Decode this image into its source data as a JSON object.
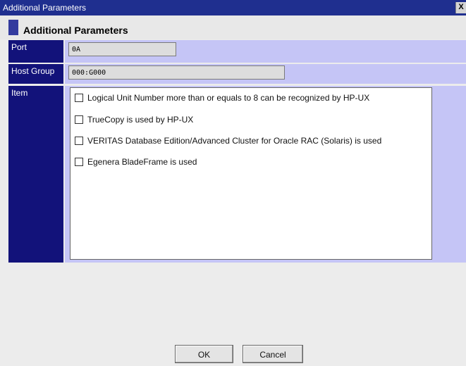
{
  "window": {
    "title": "Additional Parameters",
    "close_label": "X"
  },
  "header": {
    "title": "Additional Parameters"
  },
  "port": {
    "label": "Port",
    "value": "0A"
  },
  "host_group": {
    "label": "Host Group",
    "value": "000:G000"
  },
  "item": {
    "label": "Item",
    "options": [
      {
        "label": "Logical Unit Number more than or equals to 8 can be recognized by HP-UX",
        "checked": false
      },
      {
        "label": "TrueCopy is used by HP-UX",
        "checked": false
      },
      {
        "label": "VERITAS Database Edition/Advanced Cluster for Oracle RAC (Solaris) is used",
        "checked": false
      },
      {
        "label": "Egenera BladeFrame is used",
        "checked": false
      }
    ]
  },
  "buttons": {
    "ok_label": "OK",
    "cancel_label": "Cancel"
  },
  "colors": {
    "titlebar": "#1f2f8f",
    "label_bg": "#12127a",
    "row_bg": "#c5c5f6",
    "accent_bar": "#333b9e"
  }
}
